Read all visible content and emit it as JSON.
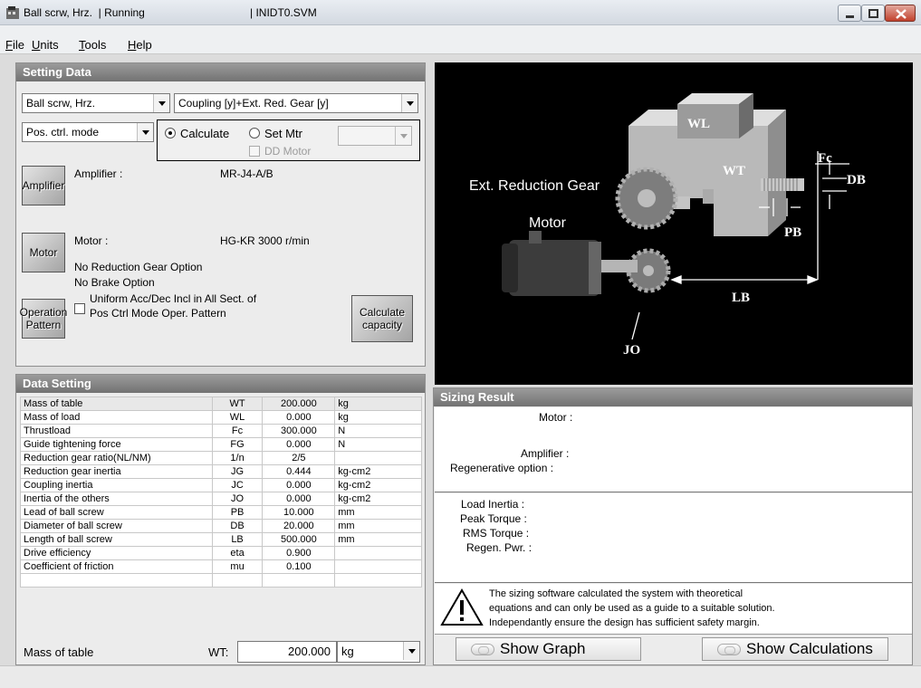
{
  "window": {
    "title": "Ball scrw, Hrz.  | Running",
    "file": "| INIDT0.SVM"
  },
  "menu": [
    {
      "accel": "F",
      "rest": "ile"
    },
    {
      "accel": "U",
      "rest": "nits"
    },
    {
      "accel": "T",
      "rest": "ools"
    },
    {
      "accel": "H",
      "rest": "elp"
    }
  ],
  "setting_data": {
    "header": "Setting Data",
    "mechanism_select": "Ball scrw, Hrz.",
    "coupling_select": "Coupling [y]+Ext. Red. Gear [y]",
    "mode_select": "Pos. ctrl. mode",
    "calculate_label": "Calculate",
    "set_mtr_label": "Set Mtr",
    "dd_motor_label": "DD Motor",
    "set_mtr_value": "",
    "amplifier_button": "Amplifier",
    "amplifier_label": "Amplifier :",
    "amplifier_value": "MR-J4-A/B",
    "motor_button": "Motor",
    "motor_label": "Motor :",
    "motor_value": "HG-KR  3000 r/min",
    "reduction_option": "No Reduction Gear Option",
    "brake_option": "No Brake Option",
    "operation_button_line1": "Operation",
    "operation_button_line2": "Pattern",
    "uniform_line1": "Uniform Acc/Dec Incl in All Sect. of",
    "uniform_line2": "Pos Ctrl Mode Oper. Pattern",
    "calc_button_line1": "Calculate",
    "calc_button_line2": "capacity"
  },
  "diagram": {
    "labels": {
      "wl": "WL",
      "wt": "WT",
      "fc": "Fc",
      "db": "DB",
      "pb": "PB",
      "lb": "LB",
      "jo": "JO",
      "gear": "Ext. Reduction Gear",
      "motor": "Motor"
    }
  },
  "data_setting": {
    "header": "Data Setting",
    "rows": [
      {
        "name": "Mass of table",
        "sym": "WT",
        "value": "200.000",
        "unit": "kg"
      },
      {
        "name": "Mass of load",
        "sym": "WL",
        "value": "0.000",
        "unit": "kg"
      },
      {
        "name": "Thrustload",
        "sym": "Fc",
        "value": "300.000",
        "unit": "N"
      },
      {
        "name": "Guide tightening force",
        "sym": "FG",
        "value": "0.000",
        "unit": "N"
      },
      {
        "name": "Reduction gear ratio(NL/NM)",
        "sym": "1/n",
        "value": "2/5",
        "unit": ""
      },
      {
        "name": "Reduction gear inertia",
        "sym": "JG",
        "value": "0.444",
        "unit": "kg-cm2"
      },
      {
        "name": "Coupling inertia",
        "sym": "JC",
        "value": "0.000",
        "unit": "kg-cm2"
      },
      {
        "name": "Inertia of the others",
        "sym": "JO",
        "value": "0.000",
        "unit": "kg-cm2"
      },
      {
        "name": "Lead of ball screw",
        "sym": "PB",
        "value": "10.000",
        "unit": "mm"
      },
      {
        "name": "Diameter of ball screw",
        "sym": "DB",
        "value": "20.000",
        "unit": "mm"
      },
      {
        "name": "Length of ball screw",
        "sym": "LB",
        "value": "500.000",
        "unit": "mm"
      },
      {
        "name": "Drive efficiency",
        "sym": "eta",
        "value": "0.900",
        "unit": ""
      },
      {
        "name": "Coefficient of friction",
        "sym": "mu",
        "value": "0.100",
        "unit": ""
      }
    ],
    "edit": {
      "name": "Mass of table",
      "sym": "WT:",
      "value": "200.000",
      "unit": "kg"
    }
  },
  "sizing_result": {
    "header": "Sizing Result",
    "motor_label": "Motor :",
    "amplifier_label": "Amplifier :",
    "regen_option_label": "Regenerative option :",
    "load_inertia_label": "Load Inertia :",
    "peak_torque_label": "Peak Torque :",
    "rms_torque_label": "RMS Torque :",
    "regen_pwr_label": "Regen. Pwr. :",
    "warning_line1": "The sizing software calculated the system with theoretical",
    "warning_line2": "equations and can only be used as a guide to a suitable solution.",
    "warning_line3": "Independantly ensure the design has sufficient safety margin.",
    "show_graph": "Show Graph",
    "show_calculations": "Show Calculations"
  }
}
